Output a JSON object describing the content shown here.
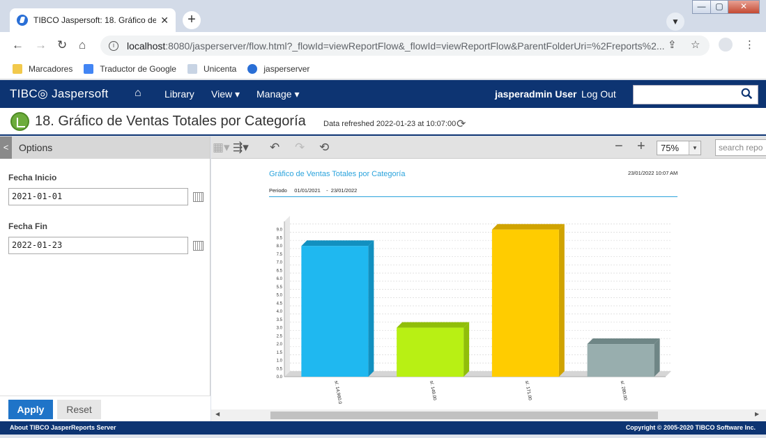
{
  "browser": {
    "tab_title": "TIBCO Jaspersoft: 18. Gráfico de V",
    "tab_close": "✕",
    "new_tab": "+",
    "url_host": "localhost",
    "url_rest": ":8080/jasperserver/flow.html?_flowId=viewReportFlow&_flowId=viewReportFlow&ParentFolderUri=%2Freports%2...",
    "bookmarks": [
      "Marcadores",
      "Traductor de Google",
      "Unicenta",
      "jasperserver"
    ],
    "window_controls": [
      "—",
      "▢",
      "✕"
    ]
  },
  "header": {
    "logo": "TIBC◎ Jaspersoft",
    "home_icon": "⌂",
    "nav": {
      "library": "Library",
      "view": "View ▾",
      "manage": "Manage ▾"
    },
    "user": "jasperadmin User",
    "logout": "Log Out"
  },
  "report": {
    "title": "18. Gráfico de Ventas Totales por Categoría",
    "refreshed": "Data refreshed 2022-01-23 at 10:07:00",
    "zoom": "75%",
    "search_placeholder": "search repo"
  },
  "options": {
    "header": "Options",
    "toggle": "<",
    "start_label": "Fecha Inicio",
    "start_value": "2021-01-01",
    "end_label": "Fecha Fin",
    "end_value": "2022-01-23",
    "apply": "Apply",
    "reset": "Reset"
  },
  "report_content": {
    "chart_title": "Gráfico de Ventas Totales por Categoría",
    "printed_date": "23/01/2022 10:07 AM",
    "period": "Periodo     01/01/2021    -  23/01/2022"
  },
  "chart_data": {
    "type": "bar",
    "categories": [
      "s/. 14,960.0",
      "s/. 149.00",
      "s/. 171.00",
      "s/. 280.00"
    ],
    "values": [
      8.0,
      3.0,
      9.0,
      2.0
    ],
    "colors": [
      "#1fb8f0",
      "#b8f014",
      "#ffcc00",
      "#98aeae"
    ],
    "side_colors": [
      "#1290c0",
      "#90be0a",
      "#d0a300",
      "#6f8686"
    ],
    "yticks": [
      "0.0",
      "0.5",
      "1.0",
      "1.5",
      "2.0",
      "2.5",
      "3.0",
      "3.5",
      "4.0",
      "4.5",
      "5.0",
      "5.5",
      "6.0",
      "6.5",
      "7.0",
      "7.5",
      "8.0",
      "8.5",
      "9.0"
    ],
    "ylim": [
      0,
      9.5
    ],
    "grid": true
  },
  "footer": {
    "left": "About TIBCO JasperReports Server",
    "right": "Copyright © 2005-2020 TIBCO Software Inc."
  }
}
